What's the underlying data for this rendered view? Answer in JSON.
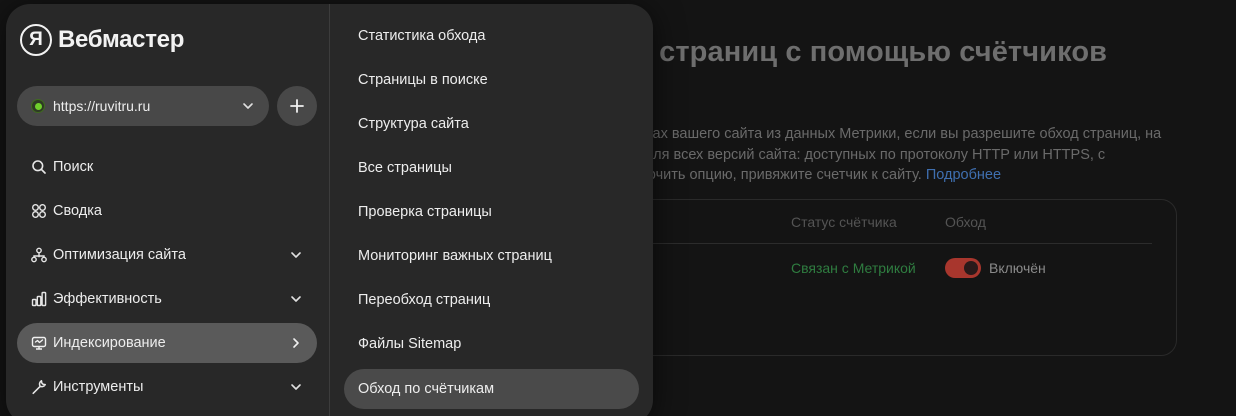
{
  "background": {
    "title": "ом страниц с помощью счётчиков",
    "description_lines": [
      "раницах вашего сайта из данных Метрики, если вы разрешите обход страниц, на",
      "вует для всех версий сайта: доступных по протоколу HTTP или HTTPS, с",
      "к включить опцию, привяжите счетчик к сайту."
    ],
    "more_link": "Подробнее",
    "table": {
      "col_status": "Статус счётчика",
      "col_crawl": "Обход",
      "status_value": "Связан с Метрикой",
      "crawl_value": "Включён"
    }
  },
  "menu": {
    "brand": {
      "logo_letter": "Я",
      "name": "Вебмастер"
    },
    "site": {
      "url": "https://ruvitru.ru",
      "status_color": "#6fcf2b"
    },
    "add_label": "+",
    "nav": [
      {
        "label": "Поиск",
        "icon": "search-icon",
        "chevron": "none"
      },
      {
        "label": "Сводка",
        "icon": "grid-icon",
        "chevron": "none"
      },
      {
        "label": "Оптимизация сайта",
        "icon": "sitemap-icon",
        "chevron": "down"
      },
      {
        "label": "Эффективность",
        "icon": "chart-icon",
        "chevron": "down"
      },
      {
        "label": "Индексирование",
        "icon": "monitor-icon",
        "chevron": "right",
        "active": true
      },
      {
        "label": "Инструменты",
        "icon": "wrench-icon",
        "chevron": "down"
      }
    ],
    "submenu": [
      {
        "label": "Статистика обхода"
      },
      {
        "label": "Страницы в поиске"
      },
      {
        "label": "Структура сайта"
      },
      {
        "label": "Все страницы"
      },
      {
        "label": "Проверка страницы"
      },
      {
        "label": "Мониторинг важных страниц"
      },
      {
        "label": "Переобход страниц"
      },
      {
        "label": "Файлы Sitemap"
      },
      {
        "label": "Обход по счётчикам",
        "active": true
      }
    ]
  },
  "colors": {
    "panel": "#282828",
    "active_item": "#5a5a5a",
    "toggle_on": "#a8362d",
    "status_green": "#2f7d40",
    "link_blue": "#3f6fb0"
  }
}
